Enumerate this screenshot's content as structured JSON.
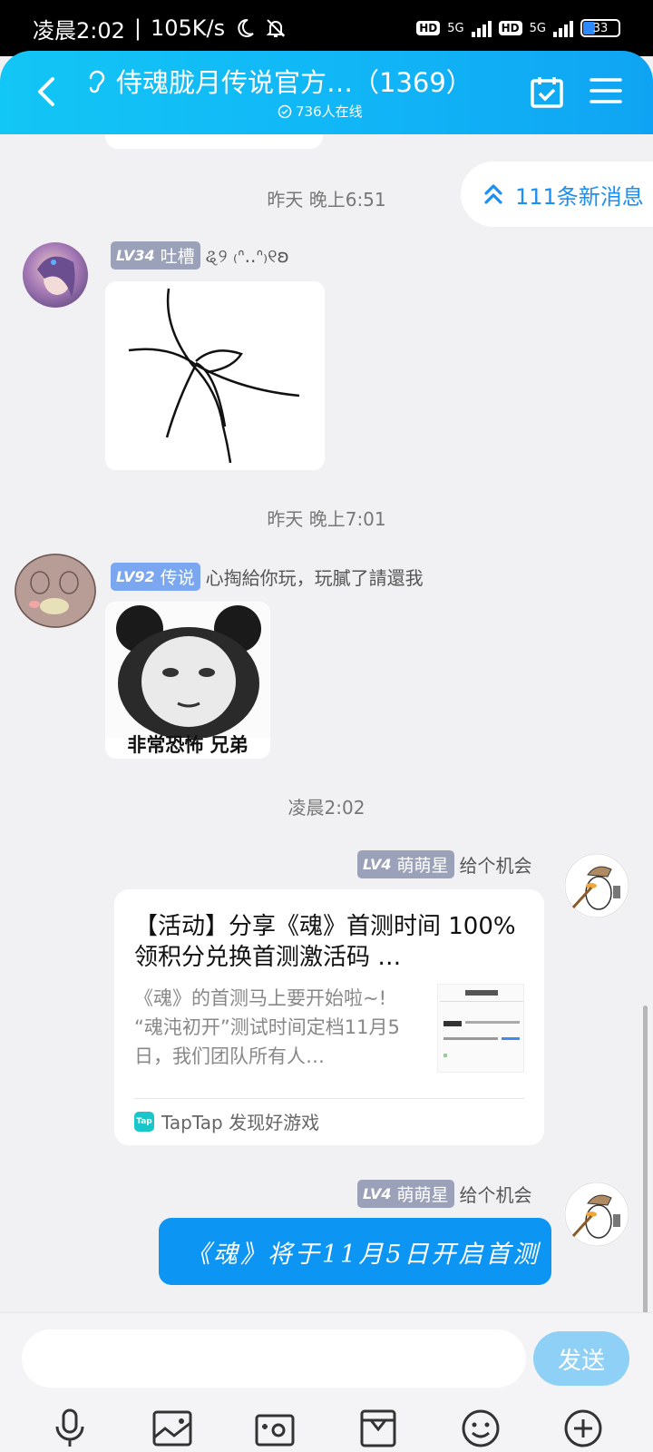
{
  "status_bar": {
    "time": "凌晨2:02",
    "speed": "105K/s",
    "signal1": "5G",
    "signal2": "5G",
    "hd1": "HD",
    "hd2": "HD",
    "battery": "33"
  },
  "header": {
    "title": "侍魂胧月传说官方…（1369）",
    "online": "736人在线"
  },
  "new_messages": "111条新消息",
  "messages": [
    {
      "time": "昨天 晚上6:51",
      "level": "LV34",
      "title_badge": "吐槽",
      "nickname": "ୡ୨ ₍ᐢ..ᐢ₎୧ʚ"
    },
    {
      "time": "昨天 晚上7:01",
      "level": "LV92",
      "title_badge": "传说",
      "nickname": "心掏給你玩，玩膩了請還我",
      "sticker_caption": "非常恐怖 兄弟"
    },
    {
      "time": "凌晨2:02",
      "level": "LV4",
      "title_badge": "萌萌星",
      "nickname": "给个机会",
      "card": {
        "title": "【活动】分享《魂》首测时间 100%领积分兑换首测激活码 …",
        "description": "《魂》的首测马上要开始啦~! “魂沌初开”测试时间定档11月5日，我们团队所有人…",
        "source_logo": "Tap",
        "source": "TapTap 发现好游戏"
      }
    },
    {
      "level": "LV4",
      "title_badge": "萌萌星",
      "nickname": "给个机会",
      "text": "《魂》将于11月5日开启首测"
    }
  ],
  "input": {
    "placeholder": "",
    "send": "发送"
  },
  "toolbar": [
    "mic-icon",
    "image-icon",
    "camera-icon",
    "file-icon",
    "emoji-icon",
    "plus-icon"
  ],
  "colors": {
    "header_gradient_start": "#12c6f5",
    "header_gradient_end": "#0fa4f3",
    "bubble_blue": "#0d95f4",
    "send_button": "#8fd0f6",
    "accent_text": "#1a8ff5"
  }
}
